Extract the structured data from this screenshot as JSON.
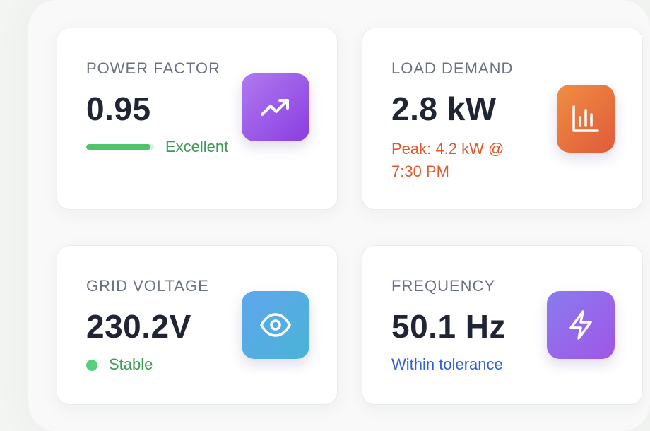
{
  "colors": {
    "green": "#3e9a54",
    "orange": "#de5a2d",
    "blue": "#2f62d6",
    "text_dark": "#1f2533",
    "text_muted": "#6b7280",
    "status_dot": "#57d07a"
  },
  "cards": {
    "power_factor": {
      "label": "POWER FACTOR",
      "value": "0.95",
      "status": "Excellent",
      "progress": 0.95,
      "icon": "trend-up-icon"
    },
    "load_demand": {
      "label": "LOAD DEMAND",
      "value": "2.8 kW",
      "peak": "Peak: 4.2 kW @ 7:30 PM",
      "icon": "bar-chart-icon"
    },
    "grid_voltage": {
      "label": "GRID VOLTAGE",
      "value": "230.2V",
      "status": "Stable",
      "icon": "eye-icon"
    },
    "frequency": {
      "label": "FREQUENCY",
      "value": "50.1 Hz",
      "status": "Within tolerance",
      "icon": "lightning-icon"
    }
  }
}
